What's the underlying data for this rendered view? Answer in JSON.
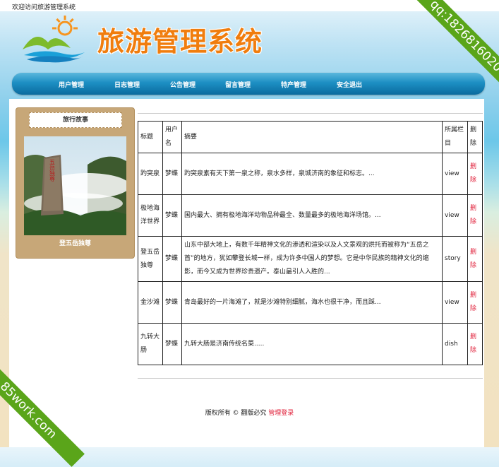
{
  "header": {
    "welcome": "欢迎访问旅游管理系统",
    "brand": "旅游管理系统"
  },
  "nav": {
    "items": [
      "用户管理",
      "日志管理",
      "公告管理",
      "留言管理",
      "特产管理",
      "安全退出"
    ]
  },
  "sidebar": {
    "title": "旅行故事",
    "caption": "登五岳独尊",
    "image_text": "五岳独尊"
  },
  "table": {
    "headers": [
      "标题",
      "用户名",
      "摘要",
      "所属栏目",
      "删除"
    ],
    "rows": [
      {
        "title": "趵突泉",
        "user": "梦蝶",
        "summary": "趵突泉素有天下第一泉之称，泉水多样，泉城济南的象征和标志。...",
        "column": "view",
        "delete": "删除"
      },
      {
        "title": "极地海洋世界",
        "user": "梦蝶",
        "summary": "国内最大、拥有极地海洋动物品种最全、数量最多的极地海洋场馆。...",
        "column": "view",
        "delete": "删除"
      },
      {
        "title": "登五岳独尊",
        "user": "梦蝶",
        "summary": "山东中部大地上，有数千年精神文化的渗透和渲染以及人文景观的烘托而被称为“五岳之首”的地方，犹如攀登长城一样，成为许多中国人的梦想。它是中华民族的精神文化的缩影，而今又成为世界珍贵遗产。泰山最引人入胜的...",
        "column": "story",
        "delete": "删除"
      },
      {
        "title": "金沙滩",
        "user": "梦蝶",
        "summary": "青岛最好的一片海滩了，就是沙滩特别细腻，海水也很干净，而且踩...",
        "column": "view",
        "delete": "删除"
      },
      {
        "title": "九转大肠",
        "user": "梦蝶",
        "summary": "九转大肠是济南传统名菜.....",
        "column": "dish",
        "delete": "删除"
      }
    ]
  },
  "footer": {
    "copyright": "版权所有 © 翻版必究",
    "login": "管理登录"
  },
  "watermarks": {
    "top_right": "qq:1826816020",
    "bottom_left": "85work.com"
  },
  "colors": {
    "brand": "#f07d0e",
    "nav": "#1d8fc3",
    "delete": "#e0203a",
    "ribbon": "#5aa51a"
  }
}
